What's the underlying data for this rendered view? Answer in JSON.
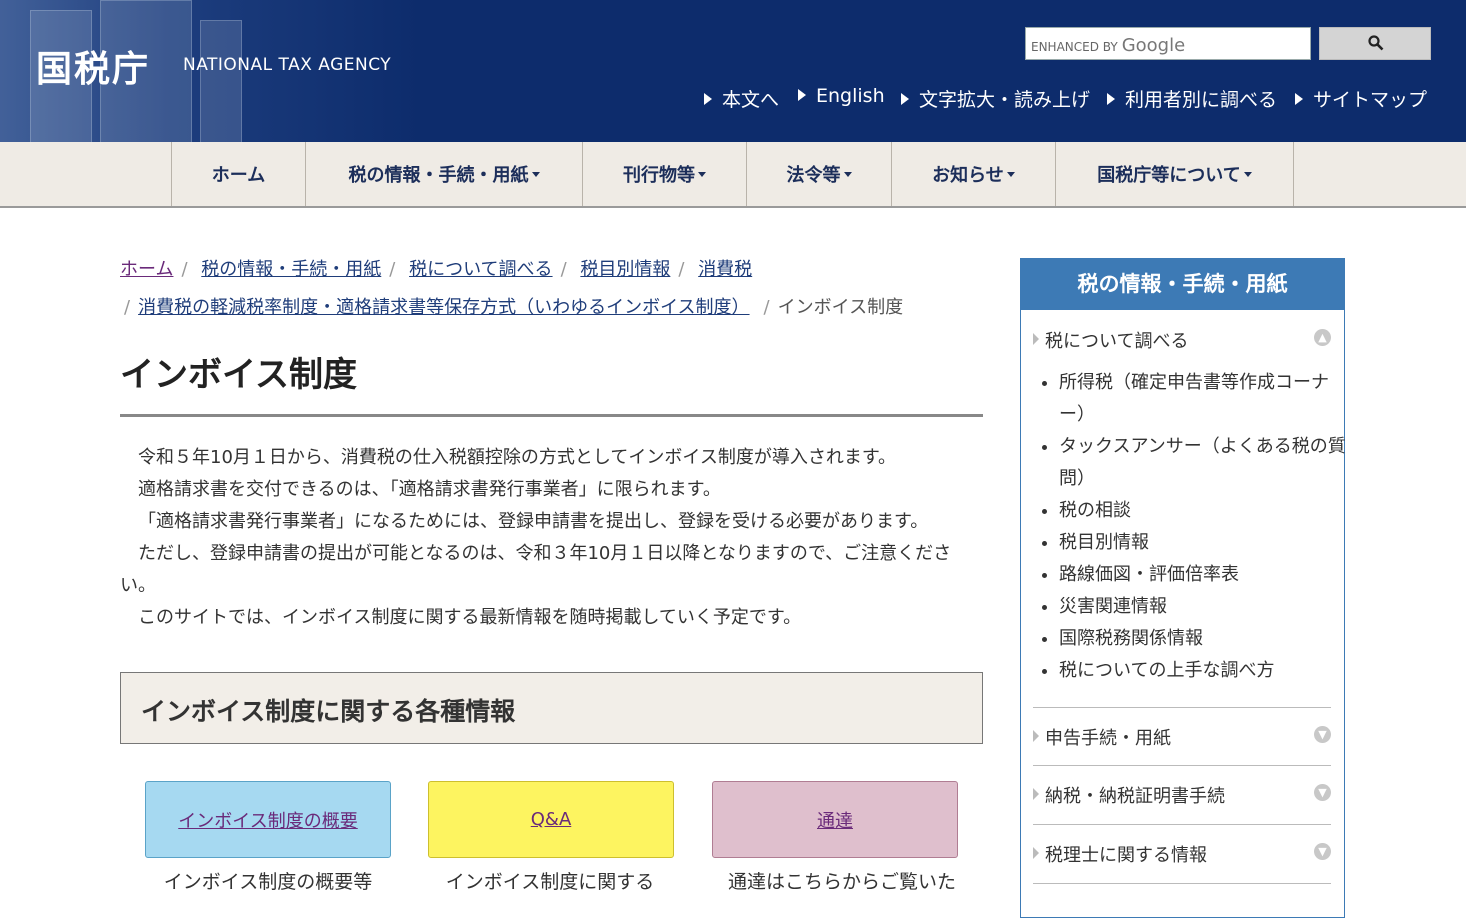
{
  "header": {
    "logo": "国税庁",
    "logo_en": "NATIONAL TAX AGENCY",
    "search": {
      "enhanced_by": "ENHANCED BY",
      "google": "Google"
    },
    "util_links": [
      "本文へ",
      "English",
      "文字拡大・読み上げ",
      "利用者別に調べる",
      "サイトマップ"
    ]
  },
  "nav": {
    "items": [
      "ホーム",
      "税の情報・手続・用紙",
      "刊行物等",
      "法令等",
      "お知らせ",
      "国税庁等について"
    ]
  },
  "breadcrumb": {
    "items": [
      "ホーム",
      "税の情報・手続・用紙",
      "税について調べる",
      "税目別情報",
      "消費税",
      "消費税の軽減税率制度・適格請求書等保存方式（いわゆるインボイス制度）"
    ],
    "current": "インボイス制度"
  },
  "main": {
    "title": "インボイス制度",
    "paragraphs": [
      "令和５年10月１日から、消費税の仕入税額控除の方式としてインボイス制度が導入されます。",
      "適格請求書を交付できるのは、「適格請求書発行事業者」に限られます。",
      "「適格請求書発行事業者」になるためには、登録申請書を提出し、登録を受ける必要があります。",
      "ただし、登録申請書の提出が可能となるのは、令和３年10月１日以降となりますので、ご注意ください。",
      "このサイトでは、インボイス制度に関する最新情報を随時掲載していく予定です。"
    ],
    "section_title": "インボイス制度に関する各種情報",
    "cards": [
      {
        "label": "インボイス制度の概要",
        "caption": "インボイス制度の概要等",
        "color": "#a6d9f1"
      },
      {
        "label": "Q&A",
        "caption": "インボイス制度に関する",
        "color": "#fdf460"
      },
      {
        "label": "通達",
        "caption": "通達はこちらからご覧いた",
        "color": "#dfbfcd"
      }
    ]
  },
  "sidebar": {
    "title": "税の情報・手続・用紙",
    "categories": [
      "税について調べる",
      "申告手続・用紙",
      "納税・納税証明書手続",
      "税理士に関する情報"
    ],
    "items": [
      "所得税（確定申告書等作成コーナー）",
      "タックスアンサー（よくある税の質問）",
      "税の相談",
      "税目別情報",
      "路線価図・評価倍率表",
      "災害関連情報",
      "国際税務関係情報",
      "税についての上手な調べ方"
    ]
  },
  "colors": {
    "header_bg": "#0d2c6c",
    "nav_bg": "#efebe5",
    "sidebar_accent": "#3d7ab5",
    "link": "#1f3d7a",
    "visited_link": "#6a2a7a"
  }
}
